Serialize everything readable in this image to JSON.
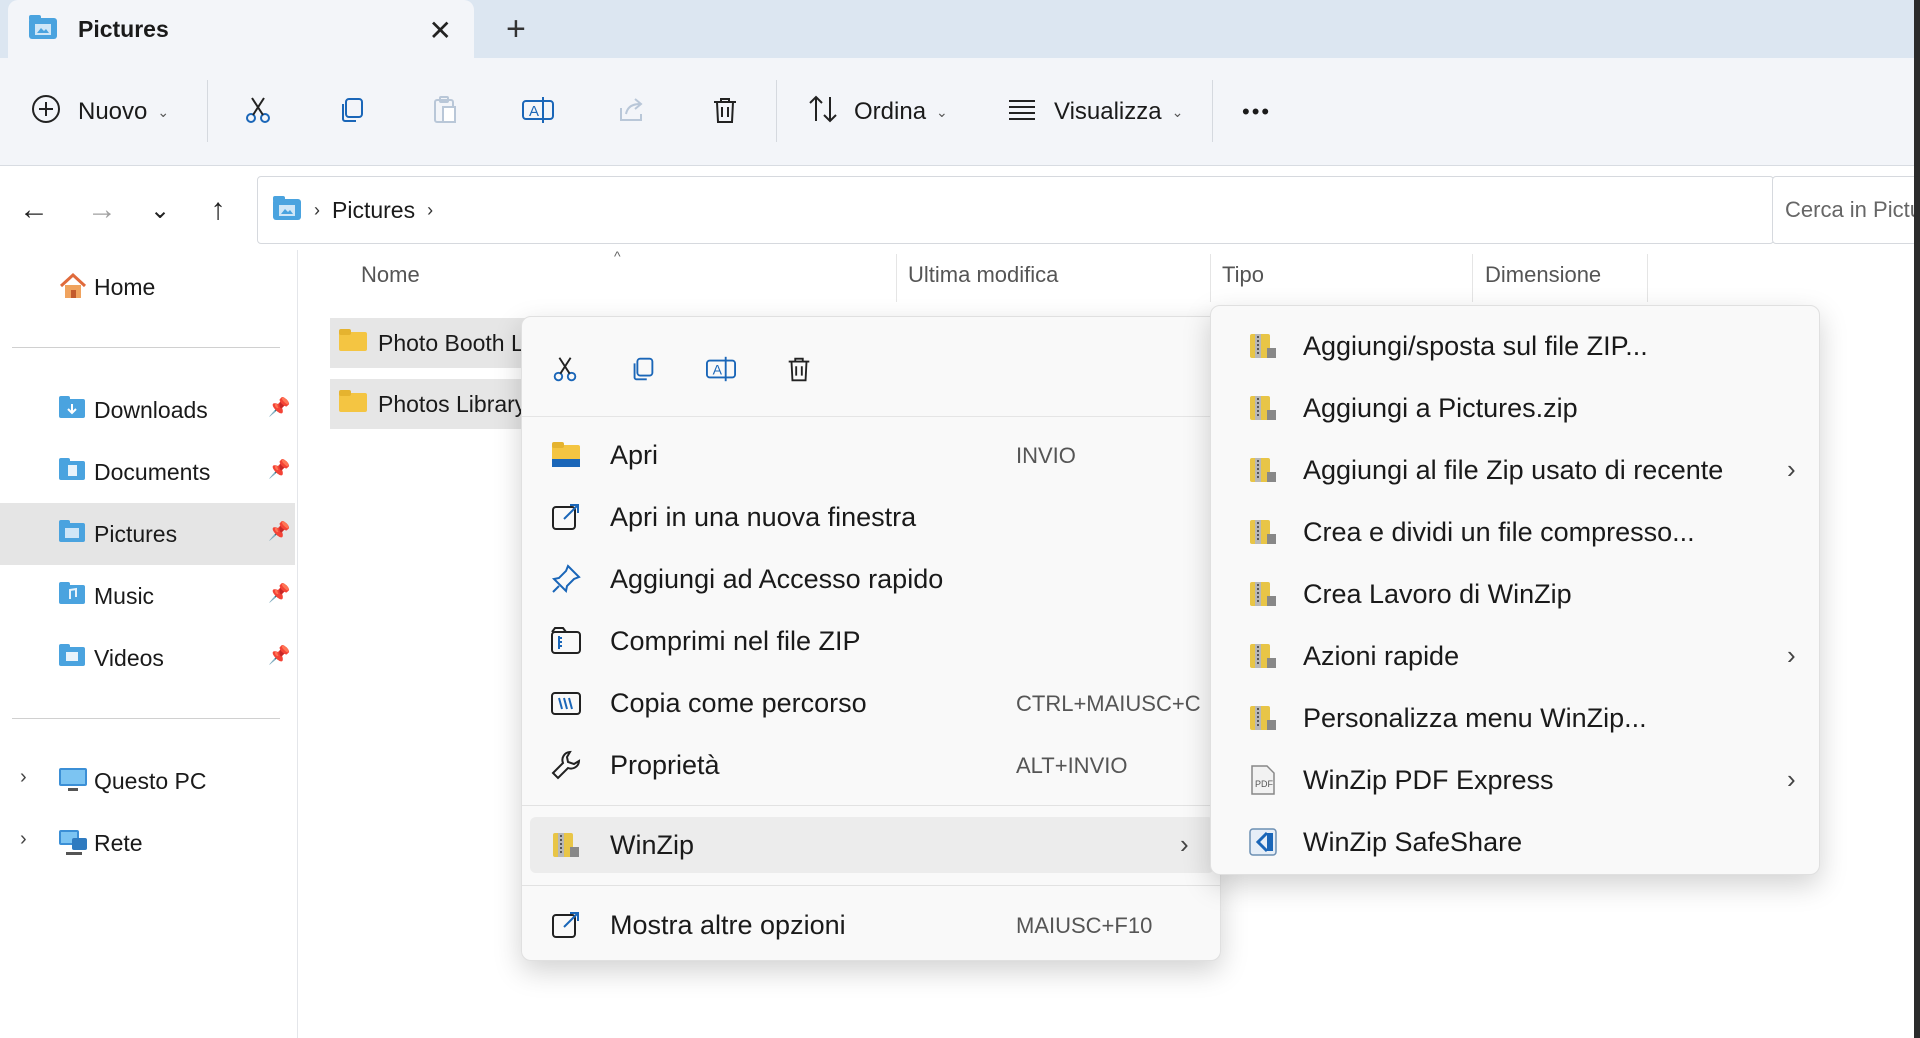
{
  "window": {
    "tab_title": "Pictures",
    "tab_close": "✕",
    "new_tab": "+"
  },
  "toolbar": {
    "new_label": "Nuovo",
    "sort_label": "Ordina",
    "view_label": "Visualizza",
    "more_label": "•••"
  },
  "navigation": {
    "back": "←",
    "forward": "→",
    "recent": "⌄",
    "up": "↑",
    "breadcrumb": [
      "Pictures"
    ],
    "search_placeholder": "Cerca in Pictures"
  },
  "sidebar": {
    "home": "Home",
    "pinned": [
      {
        "label": "Downloads"
      },
      {
        "label": "Documents"
      },
      {
        "label": "Pictures"
      },
      {
        "label": "Music"
      },
      {
        "label": "Videos"
      }
    ],
    "this_pc": "Questo PC",
    "network": "Rete"
  },
  "file_list": {
    "columns": [
      "Nome",
      "Ultima modifica",
      "Tipo",
      "Dimensione"
    ],
    "sort_indicator": "^",
    "rows": [
      {
        "name": "Photo Booth Library"
      },
      {
        "name": "Photos Library"
      }
    ]
  },
  "context_menu": {
    "items": [
      {
        "label": "Apri",
        "shortcut": "INVIO",
        "icon": "folder-open-icon"
      },
      {
        "label": "Apri in una nuova finestra",
        "shortcut": "",
        "icon": "open-new-window-icon"
      },
      {
        "label": "Aggiungi ad Accesso rapido",
        "shortcut": "",
        "icon": "pin-icon"
      },
      {
        "label": "Comprimi nel file ZIP",
        "shortcut": "",
        "icon": "zip-icon"
      },
      {
        "label": "Copia come percorso",
        "shortcut": "CTRL+MAIUSC+C",
        "icon": "copy-path-icon"
      },
      {
        "label": "Proprietà",
        "shortcut": "ALT+INVIO",
        "icon": "wrench-icon"
      }
    ],
    "winzip_label": "WinZip",
    "more_options_label": "Mostra altre opzioni",
    "more_options_shortcut": "MAIUSC+F10"
  },
  "winzip_submenu": {
    "items": [
      {
        "label": "Aggiungi/sposta sul file ZIP...",
        "has_submenu": false,
        "icon": "winzip-icon"
      },
      {
        "label": "Aggiungi a Pictures.zip",
        "has_submenu": false,
        "icon": "winzip-icon"
      },
      {
        "label": "Aggiungi al file Zip usato di recente",
        "has_submenu": true,
        "icon": "winzip-icon"
      },
      {
        "label": "Crea e dividi un file compresso...",
        "has_submenu": false,
        "icon": "winzip-icon"
      },
      {
        "label": "Crea Lavoro di WinZip",
        "has_submenu": false,
        "icon": "winzip-icon"
      },
      {
        "label": "Azioni rapide",
        "has_submenu": true,
        "icon": "winzip-icon"
      },
      {
        "label": "Personalizza menu WinZip...",
        "has_submenu": false,
        "icon": "winzip-icon"
      },
      {
        "label": "WinZip PDF Express",
        "has_submenu": true,
        "icon": "pdf-icon"
      },
      {
        "label": "WinZip SafeShare",
        "has_submenu": false,
        "icon": "safeshare-icon"
      }
    ],
    "submenu_arrow": "›"
  },
  "colors": {
    "tabstrip": "#dce6f1",
    "folder_yellow": "#f4c542",
    "folder_blue": "#4aa3df",
    "accent": "#0067c0"
  }
}
